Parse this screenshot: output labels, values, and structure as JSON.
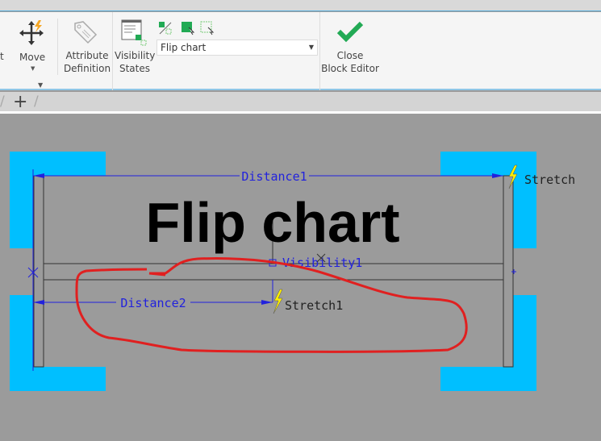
{
  "ribbon": {
    "partial_label": "t",
    "move_label": "Move",
    "attribute_definition_label": "Attribute\nDefinition",
    "visibility_states_label": "Visibility\nStates",
    "visibility_state_selected": "Flip chart",
    "close_block_editor_label": "Close\nBlock Editor"
  },
  "tabs": {
    "add_label": "+"
  },
  "drawing": {
    "title_text": "Flip chart",
    "distance1": "Distance1",
    "distance2": "Distance2",
    "stretch": "Stretch",
    "stretch1": "Stretch1",
    "visibility1": "Visibility1"
  },
  "colors": {
    "accent": "#2a9bd6",
    "param": "#2222dd",
    "grip": "#00bfff",
    "annotation": "#e02020",
    "check": "#22aa55"
  }
}
